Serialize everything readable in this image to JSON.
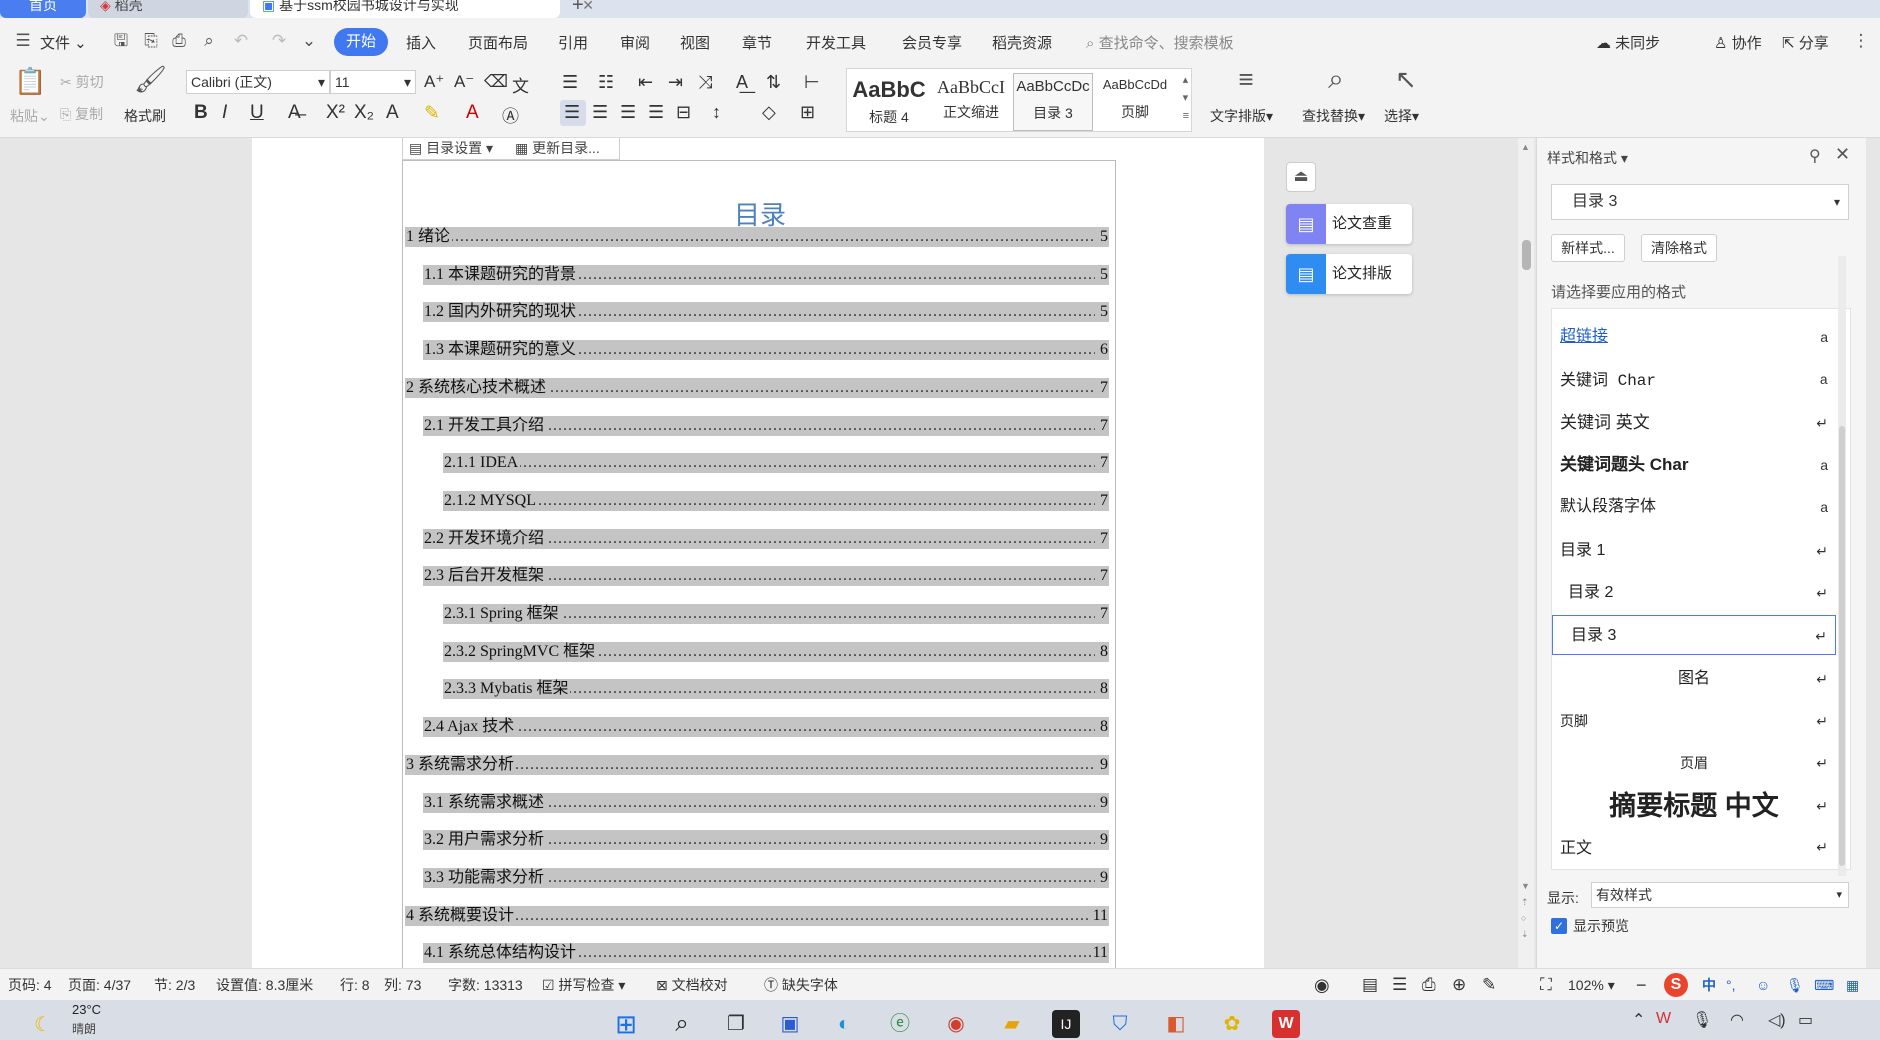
{
  "tabs": [
    {
      "label": "首页"
    },
    {
      "label": "稻壳"
    },
    {
      "label": "基于ssm校园书城设计与实现"
    }
  ],
  "menu": {
    "file": "文件",
    "items": [
      "开始",
      "插入",
      "页面布局",
      "引用",
      "审阅",
      "视图",
      "章节",
      "开发工具",
      "会员专享",
      "稻壳资源"
    ],
    "search_placeholder": "查找命令、搜索模板",
    "right": [
      "未同步",
      "协作",
      "分享"
    ]
  },
  "ribbon": {
    "paste": "粘贴",
    "cut": "剪切",
    "copy": "复制",
    "format_painter": "格式刷",
    "font_name": "Calibri (正文)",
    "font_size": "11",
    "styles": [
      {
        "sample": "AaBbC",
        "label": "标题 4"
      },
      {
        "sample": "AaBbCcI",
        "label": "正文缩进"
      },
      {
        "sample": "AaBbCcDc",
        "label": "目录 3"
      },
      {
        "sample": "AaBbCcDd",
        "label": "页脚"
      }
    ],
    "text_layout": "文字排版",
    "find_replace": "查找替换",
    "select": "选择"
  },
  "toc": {
    "toolbar_settings": "目录设置",
    "toolbar_update": "更新目录...",
    "title": "目录",
    "entries": [
      {
        "text": "1  绪论",
        "page": "5",
        "level": 1
      },
      {
        "text": "1.1      本课题研究的背景",
        "page": "5",
        "level": 2
      },
      {
        "text": "1.2      国内外研究的现状",
        "page": "5",
        "level": 2
      },
      {
        "text": "1.3      本课题研究的意义",
        "page": "6",
        "level": 2
      },
      {
        "text": "2  系统核心技术概述",
        "page": "7",
        "level": 1
      },
      {
        "text": "2.1  开发工具介绍",
        "page": "7",
        "level": 2
      },
      {
        "text": "2.1.1 IDEA",
        "page": "7",
        "level": 3
      },
      {
        "text": "2.1.2 MYSQL",
        "page": "7",
        "level": 3
      },
      {
        "text": "2.2  开发环境介绍",
        "page": "7",
        "level": 2
      },
      {
        "text": "2.3  后台开发框架",
        "page": "7",
        "level": 2
      },
      {
        "text": "2.3.1 Spring 框架",
        "page": "7",
        "level": 3
      },
      {
        "text": "2.3.2 SpringMVC 框架",
        "page": "8",
        "level": 3
      },
      {
        "text": "2.3.3 Mybatis 框架",
        "page": "8",
        "level": 3
      },
      {
        "text": "2.4 Ajax 技术",
        "page": "8",
        "level": 2
      },
      {
        "text": "3  系统需求分析",
        "page": "9",
        "level": 1
      },
      {
        "text": "3.1  系统需求概述",
        "page": "9",
        "level": 2
      },
      {
        "text": "3.2  用户需求分析",
        "page": "9",
        "level": 2
      },
      {
        "text": "3.3  功能需求分析",
        "page": "9",
        "level": 2
      },
      {
        "text": "4  系统概要设计",
        "page": "11",
        "level": 1
      },
      {
        "text": "4.1  系统总体结构设计",
        "page": "11",
        "level": 2
      }
    ]
  },
  "float_tools": {
    "check": "论文查重",
    "layout": "论文排版"
  },
  "panel": {
    "title": "样式和格式",
    "current_style": "目录 3",
    "new_style": "新样式...",
    "clear_format": "清除格式",
    "hint": "请选择要应用的格式",
    "styles": [
      {
        "label": "超链接",
        "mark": "a"
      },
      {
        "label": "关键词 Char",
        "mark": "a"
      },
      {
        "label": "关键词  英文",
        "mark": "↵"
      },
      {
        "label": "关键词题头 Char",
        "mark": "a"
      },
      {
        "label": "默认段落字体",
        "mark": "a"
      },
      {
        "label": "目录 1",
        "mark": "↵"
      },
      {
        "label": "目录 2",
        "mark": "↵"
      },
      {
        "label": "目录 3",
        "mark": "↵"
      },
      {
        "label": "图名",
        "mark": "↵"
      },
      {
        "label": "页脚",
        "mark": "↵"
      },
      {
        "label": "页眉",
        "mark": "↵"
      },
      {
        "label": "摘要标题  中文",
        "mark": "↵"
      },
      {
        "label": "正文",
        "mark": "↵"
      }
    ],
    "show_label": "显示:",
    "show_value": "有效样式",
    "preview_label": "显示预览"
  },
  "status": {
    "page_code": "页码: 4",
    "page": "页面: 4/37",
    "section": "节: 2/3",
    "setting": "设置值: 8.3厘米",
    "row": "行: 8",
    "col": "列: 73",
    "words": "字数: 13313",
    "spell": "拼写检查",
    "proof": "文档校对",
    "missing_font": "缺失字体",
    "zoom": "102%"
  },
  "taskbar": {
    "temp": "23°C",
    "weather": "晴朗",
    "ime": "中"
  },
  "colors": {
    "accent": "#3f78f0",
    "toc_highlight": "#c4c4c4",
    "toc_title": "#4f81bd"
  }
}
